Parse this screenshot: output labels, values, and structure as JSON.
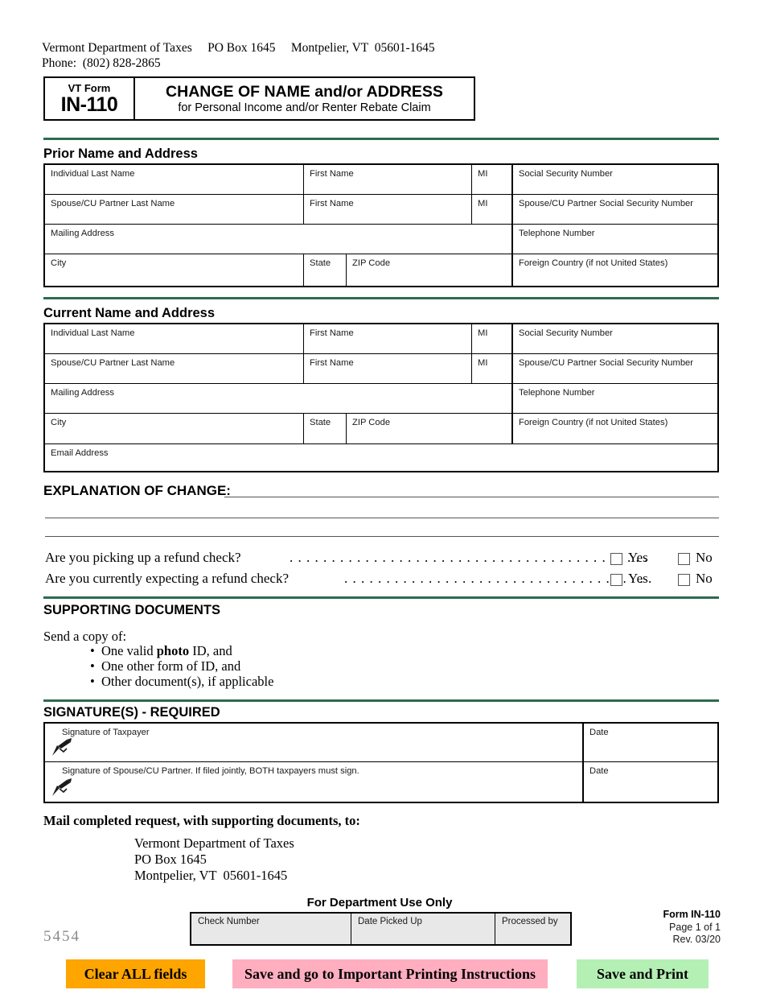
{
  "header": {
    "agency_line_1": "Vermont Department of Taxes     PO Box 1645     Montpelier, VT  05601-1645",
    "agency_line_2": "Phone:  (802) 828-2865",
    "vt_form_label": "VT Form",
    "form_number": "IN-110",
    "form_title": "CHANGE OF NAME and/or ADDRESS",
    "form_subtitle": "for Personal Income and/or Renter Rebate Claim"
  },
  "colors": {
    "rule_green": "#2E6B4F",
    "clear_button": "#FFA500",
    "save_instructions_button": "#FFAEC0",
    "save_print_button": "#B4F0B4",
    "dept_table_fill": "#E8E8E8"
  },
  "prior_section": {
    "heading": "Prior Name and Address",
    "rows": [
      [
        "Individual Last Name",
        "First Name",
        "MI",
        "Social Security Number"
      ],
      [
        "Spouse/CU Partner Last Name",
        "First Name",
        "MI",
        "Spouse/CU Partner Social Security Number"
      ],
      [
        "Mailing Address",
        "Telephone Number"
      ],
      [
        "City",
        "State",
        "ZIP Code",
        "Foreign Country (if not United States)"
      ]
    ]
  },
  "current_section": {
    "heading": "Current Name and Address",
    "rows": [
      [
        "Individual Last Name",
        "First Name",
        "MI",
        "Social Security Number"
      ],
      [
        "Spouse/CU Partner Last Name",
        "First Name",
        "MI",
        "Spouse/CU Partner Social Security Number"
      ],
      [
        "Mailing Address",
        "Telephone Number"
      ],
      [
        "City",
        "State",
        "ZIP Code",
        "Foreign Country (if not United States)"
      ],
      [
        "Email Address"
      ]
    ]
  },
  "explanation": {
    "heading": "EXPLANATION OF CHANGE:",
    "value_line_1": "",
    "value_line_2": "",
    "value_line_3": ""
  },
  "questions": [
    {
      "text": "Are you picking up a refund check?",
      "leader": ". . . . . . . . . . . . . . . . . . . . . . . . . . . . . . . . . . . . . . . . . . . . . . . . . . . . . .",
      "yes_label": "Yes",
      "no_label": "No"
    },
    {
      "text": "Are you currently expecting a refund check?",
      "leader": ". . . . . . . . . . . . . . . . . . . . . . . . . . . . . . . . . . . . . . . . . . . . . . . .",
      "yes_label": "Yes",
      "no_label": "No"
    }
  ],
  "supporting_documents": {
    "heading": "SUPPORTING DOCUMENTS",
    "intro": "Send a copy of:",
    "items": [
      {
        "prefix": "One valid ",
        "bold": "photo",
        "suffix": " ID, and"
      },
      {
        "prefix": "One other form of ID, and",
        "bold": "",
        "suffix": ""
      },
      {
        "prefix": "Other document(s), if applicable",
        "bold": "",
        "suffix": ""
      }
    ]
  },
  "signature_section": {
    "heading": "SIGNATURE(S) - REQUIRED",
    "rows": [
      {
        "label": "Signature of Taxpayer",
        "date_label": "Date"
      },
      {
        "label": "Signature of Spouse/CU Partner.  If filed jointly, BOTH taxpayers must sign.",
        "date_label": "Date"
      }
    ]
  },
  "mailing": {
    "heading": "Mail completed request, with supporting documents, to:",
    "address": "Vermont Department of Taxes\nPO Box 1645\nMontpelier, VT  05601-1645"
  },
  "department_use": {
    "heading": "For Department Use Only",
    "columns": [
      "Check Number",
      "Date Picked Up",
      "Processed by"
    ]
  },
  "footer": {
    "serial": "5454",
    "form_label": "Form IN-110",
    "page_label": "Page 1 of 1",
    "revision_label": "Rev. 03/20"
  },
  "actions": {
    "clear_label": "Clear ALL fields",
    "save_instructions_label": "Save and go to Important Printing Instructions",
    "save_print_label": "Save and Print"
  }
}
